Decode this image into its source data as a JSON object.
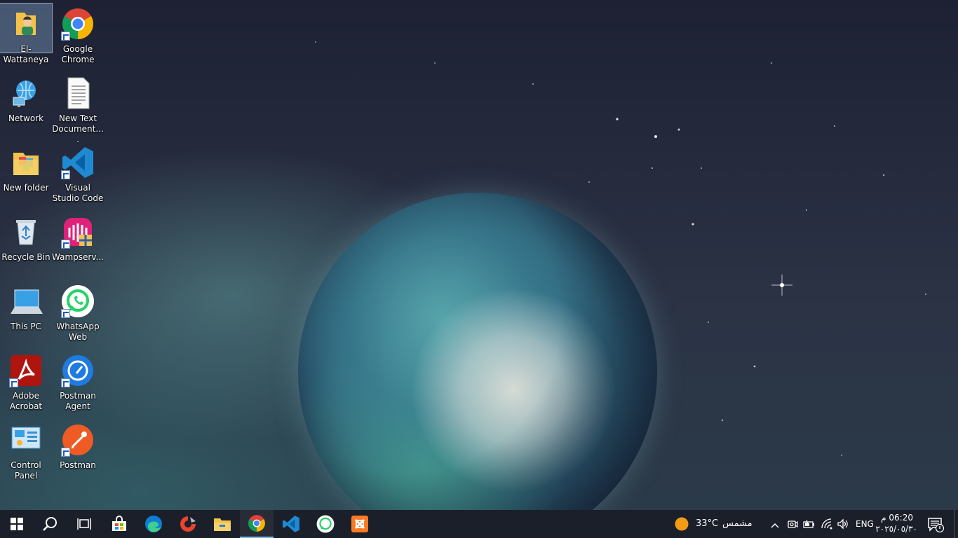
{
  "desktop": {
    "icons": [
      {
        "label": "El-Wattaneya"
      },
      {
        "label": "Google Chrome"
      },
      {
        "label": "Network"
      },
      {
        "label": "New Text Document...."
      },
      {
        "label": "New folder"
      },
      {
        "label": "Visual Studio Code"
      },
      {
        "label": "Recycle Bin"
      },
      {
        "label": "Wampserv..."
      },
      {
        "label": "This PC"
      },
      {
        "label": "WhatsApp Web"
      },
      {
        "label": "Adobe Acrobat"
      },
      {
        "label": "Postman Agent"
      },
      {
        "label": "Control Panel"
      },
      {
        "label": "Postman"
      }
    ]
  },
  "taskbar": {
    "weather": {
      "temp": "33°C",
      "condition": "مشمس",
      "icon": "sun-icon"
    },
    "language": "ENG",
    "time": "06:20 م",
    "date": "٢٠٢٥/٠٥/٣٠"
  },
  "colors": {
    "taskbar": "#1b1f2a",
    "accent": "#7fb6ee"
  }
}
